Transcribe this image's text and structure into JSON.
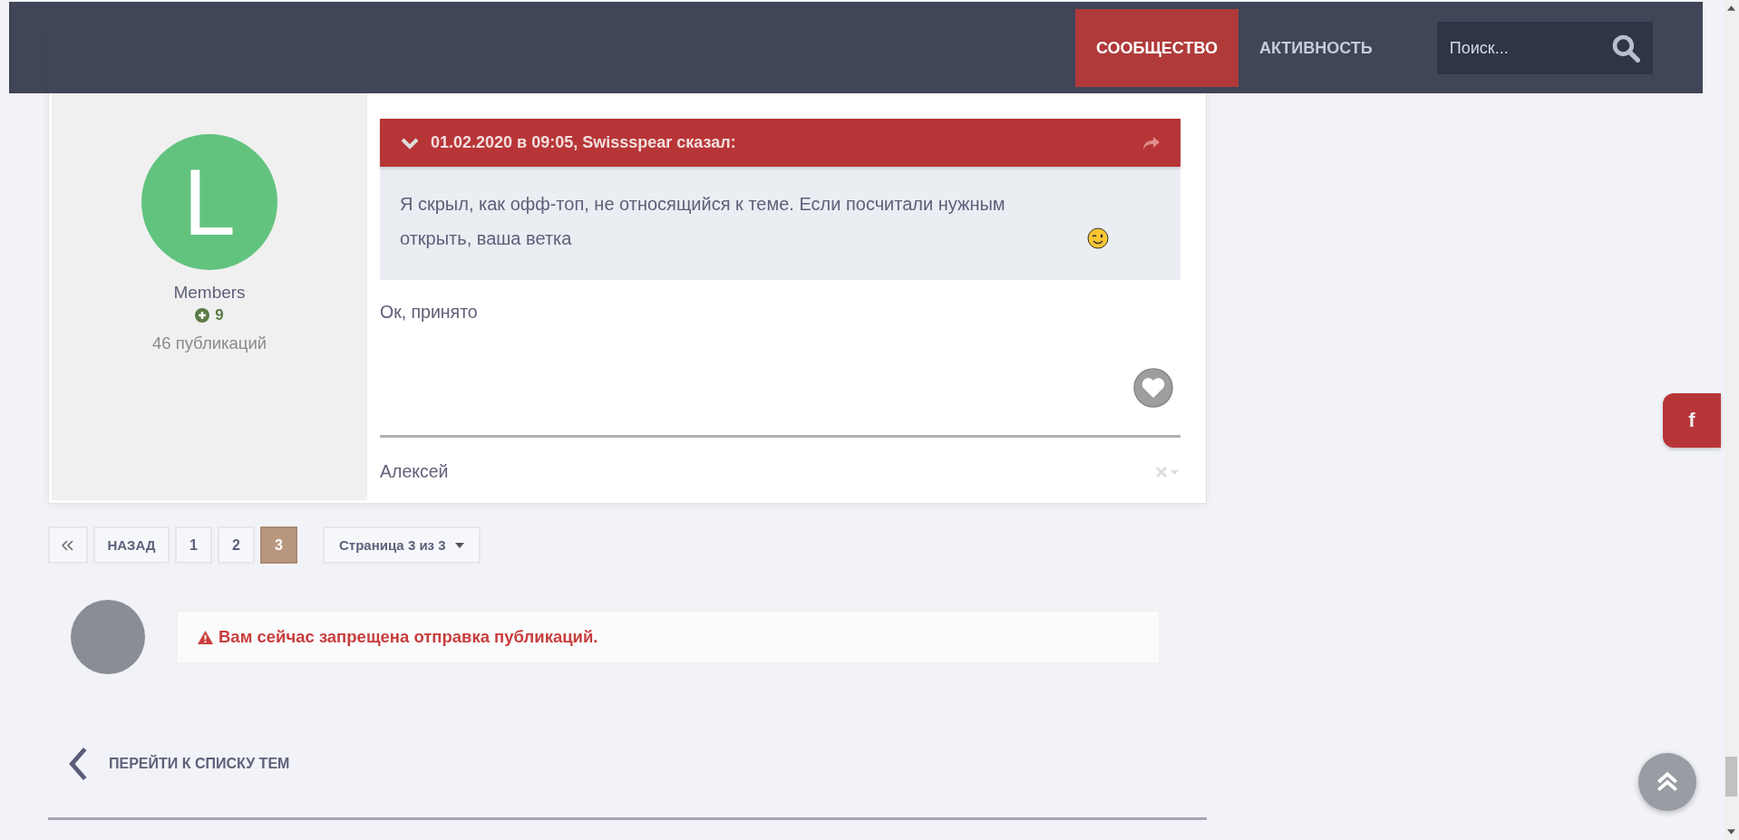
{
  "header": {
    "nav": [
      {
        "label": "СООБЩЕСТВО",
        "selected": true
      },
      {
        "label": "АКТИВНОСТЬ",
        "selected": false
      }
    ],
    "search": {
      "placeholder": "Поиск..."
    }
  },
  "post": {
    "avatar_letter": "L",
    "group": "Members",
    "reputation": "9",
    "post_count": "46 публикаций",
    "quote": {
      "citation": "01.02.2020 в 09:05, Swissspear сказал:",
      "text": "Я скрыл, как офф-топ, не относящийся к теме. Если посчитали нужным открыть, ваша ветка"
    },
    "body": "Ок, принято",
    "signature": "Алексей"
  },
  "pagination": {
    "prev": "НАЗАД",
    "pages": [
      {
        "label": "1",
        "selected": false
      },
      {
        "label": "2",
        "selected": false
      },
      {
        "label": "3",
        "selected": true
      }
    ],
    "page_menu": "Страница 3 из 3"
  },
  "notice": "Вам сейчас запрещена отправка публикаций.",
  "back_link": "ПЕРЕЙТИ К СПИСКУ ТЕМ",
  "share": {
    "label": "f"
  }
}
